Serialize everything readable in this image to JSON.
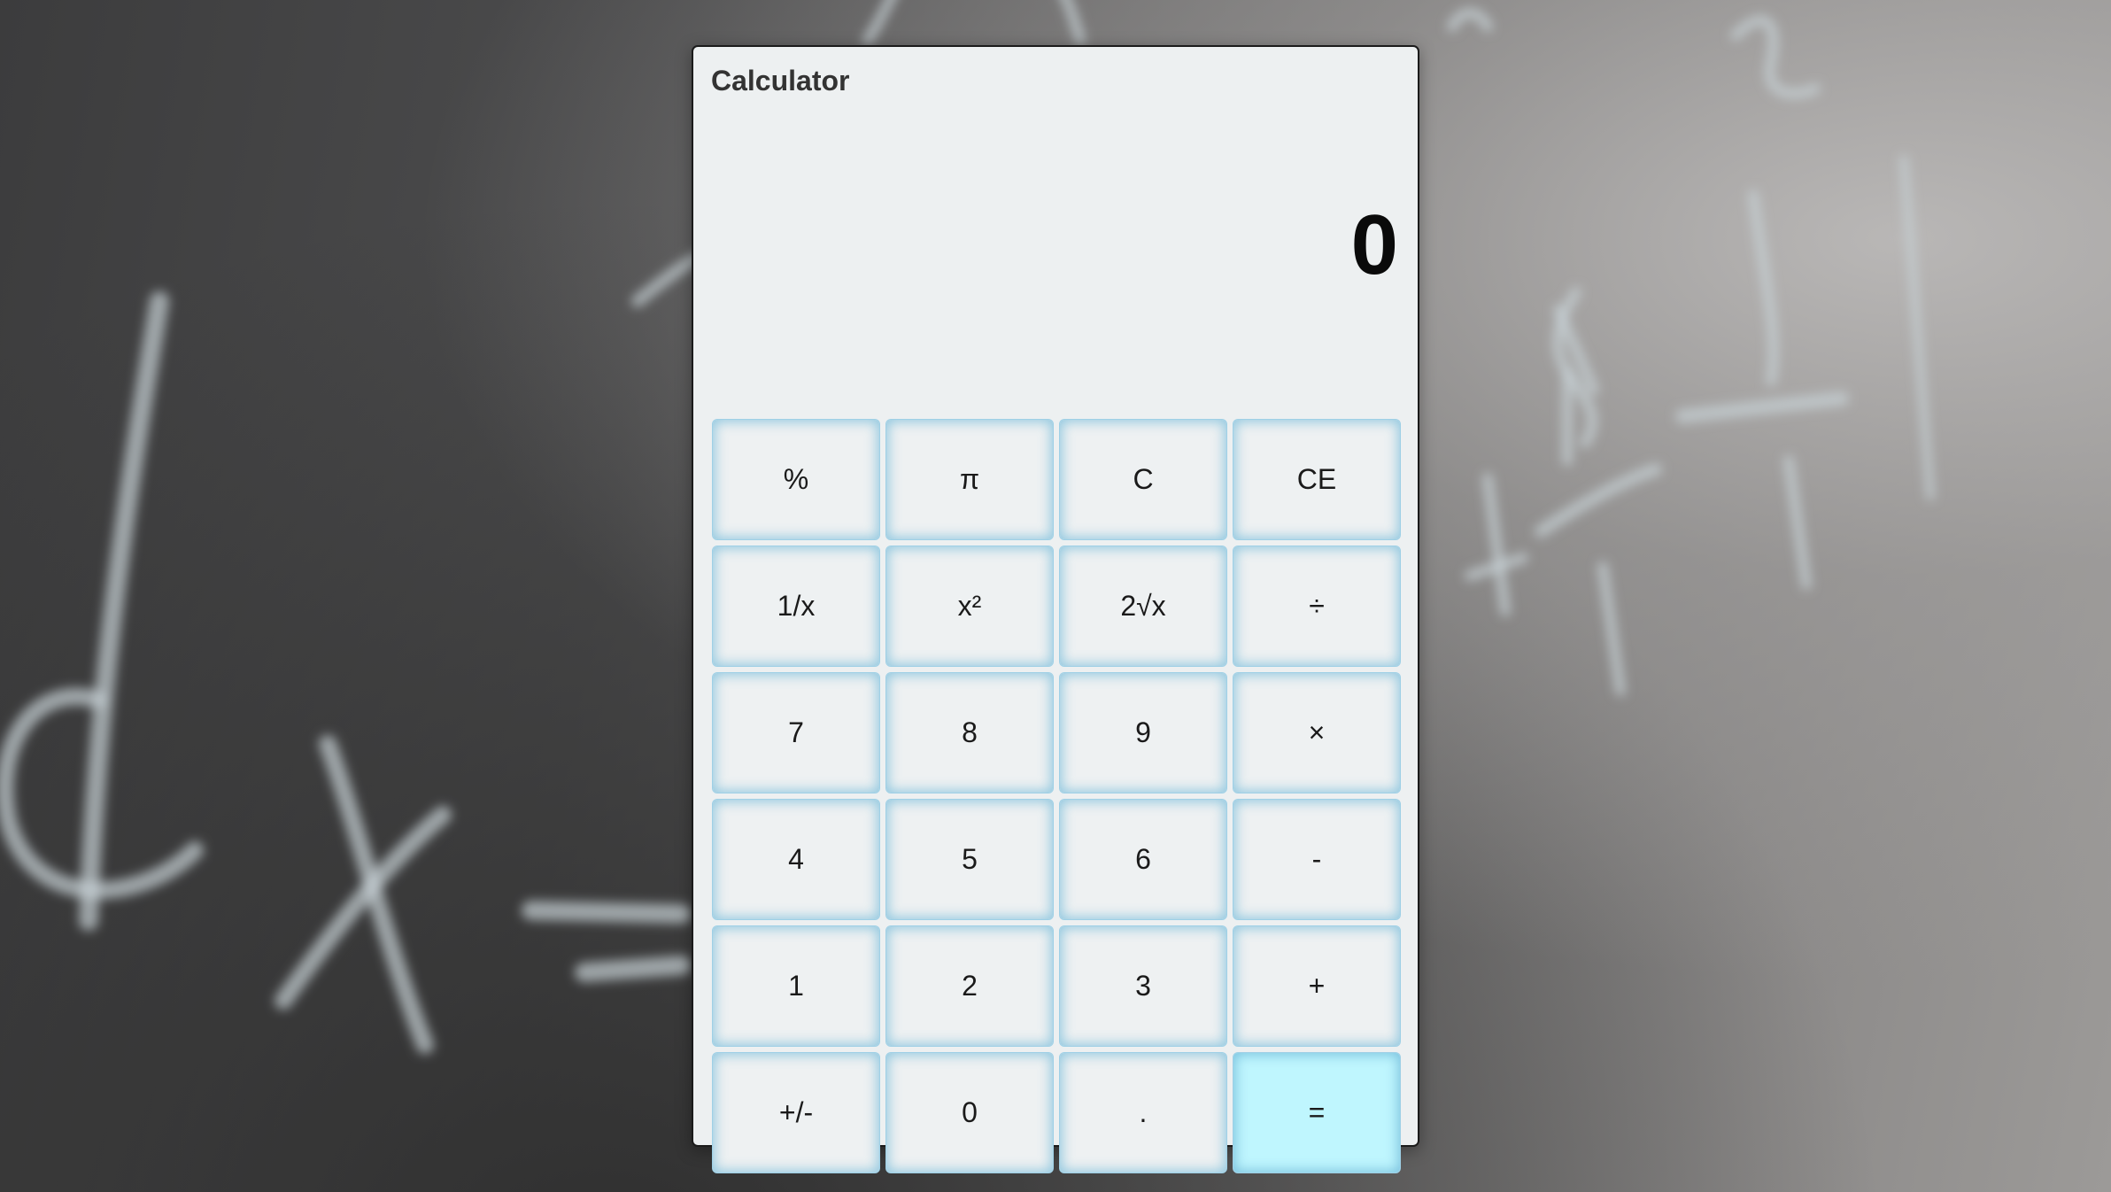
{
  "app": {
    "title": "Calculator"
  },
  "display": {
    "value": "0"
  },
  "keys": [
    {
      "label": "%"
    },
    {
      "label": "π"
    },
    {
      "label": "C"
    },
    {
      "label": "CE"
    },
    {
      "label": "1/x"
    },
    {
      "label": "x²"
    },
    {
      "label": "2√x"
    },
    {
      "label": "÷"
    },
    {
      "label": "7"
    },
    {
      "label": "8"
    },
    {
      "label": "9"
    },
    {
      "label": "×"
    },
    {
      "label": "4"
    },
    {
      "label": "5"
    },
    {
      "label": "6"
    },
    {
      "label": "-"
    },
    {
      "label": "1"
    },
    {
      "label": "2"
    },
    {
      "label": "3"
    },
    {
      "label": "+"
    },
    {
      "label": "+/-"
    },
    {
      "label": "0"
    },
    {
      "label": "."
    },
    {
      "label": "="
    }
  ],
  "colors": {
    "panel": "#edf0f1",
    "key_glow": "#6fb8d8",
    "equals_fill": "#bff6fe"
  }
}
